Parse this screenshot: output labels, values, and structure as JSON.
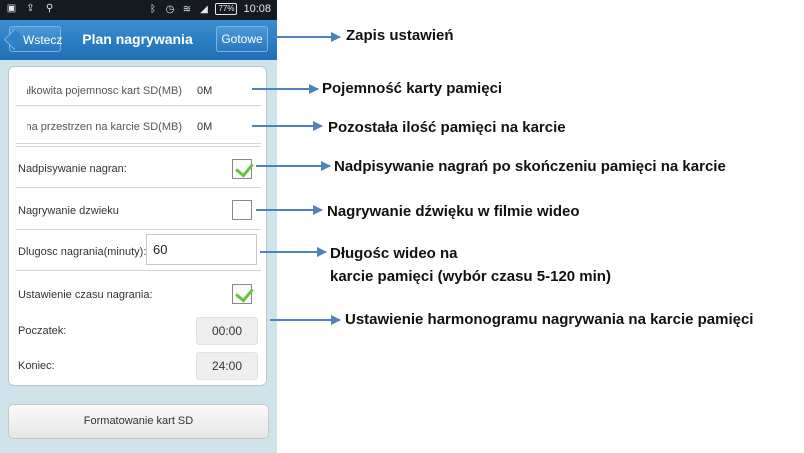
{
  "statusbar": {
    "battery": "77%",
    "time": "10:08"
  },
  "navbar": {
    "back_label": "Wstecz",
    "title": "Plan nagrywania",
    "done_label": "Gotowe"
  },
  "settings": {
    "total_capacity_label": "Całkowita pojemnosc kart SD(MB):",
    "total_capacity_value": "0M",
    "free_space_label": "Wolna przestrzen na karcie SD(MB):",
    "free_space_value": "0M",
    "overwrite_label": "Nadpisywanie nagran:",
    "overwrite_checked": true,
    "audio_label": "Nagrywanie dzwieku",
    "audio_checked": false,
    "duration_label": "Dlugosc nagrania(minuty):",
    "duration_value": "60",
    "schedule_label": "Ustawienie czasu nagrania:",
    "schedule_checked": true,
    "start_label": "Poczatek:",
    "start_value": "00:00",
    "end_label": "Koniec:",
    "end_value": "24:00"
  },
  "format_button": "Formatowanie kart SD",
  "annotations": {
    "save": "Zapis ustawień",
    "capacity": "Pojemność karty pamięci",
    "remaining": "Pozostała ilość pamięci na karcie",
    "overwrite": "Nadpisywanie nagrań po skończeniu pamięci na karcie",
    "audio": "Nagrywanie dźwięku w filmie wideo",
    "duration_line1": "Długośc wideo na",
    "duration_line2": "karcie pamięci  (wybór czasu 5-120 min)",
    "schedule": "Ustawienie harmonogramu nagrywania na karcie pamięci"
  },
  "colors": {
    "arrow": "#4f81bd",
    "nav_blue": "#2a78bd",
    "check_green": "#6ac040"
  }
}
